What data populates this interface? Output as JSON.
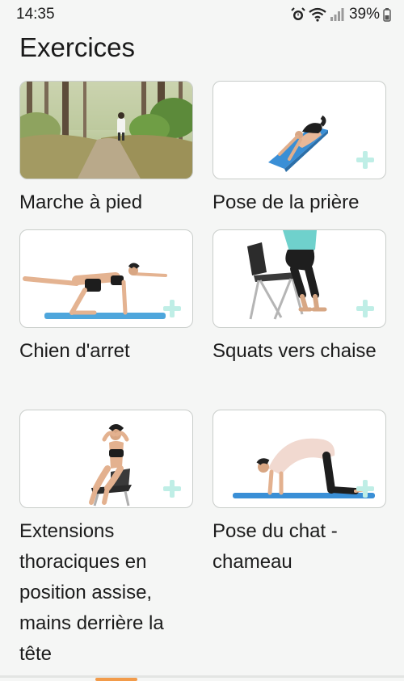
{
  "status_bar": {
    "time": "14:35",
    "battery": "39%",
    "icons": [
      "alarm-icon",
      "wifi-icon",
      "signal-icon",
      "battery-icon"
    ]
  },
  "page": {
    "title": "Exercices"
  },
  "exercises": [
    {
      "label": "Marche à pied",
      "image": "forest-walk-photo"
    },
    {
      "label": "Pose de la prière",
      "image": "prayer-pose-illustration"
    },
    {
      "label": "Chien d'arret",
      "image": "bird-dog-illustration"
    },
    {
      "label": "Squats vers chaise",
      "image": "chair-squat-illustration"
    },
    {
      "label": "Extensions thoraciques en position assise, mains derrière la tête",
      "image": "seated-thoracic-extension-illustration"
    },
    {
      "label": "Pose du chat - chameau",
      "image": "cat-camel-illustration"
    }
  ],
  "colors": {
    "accent_plus": "#bfeee6",
    "mat": "#3a8fd6",
    "bottom_accent": "#f29b4a"
  }
}
